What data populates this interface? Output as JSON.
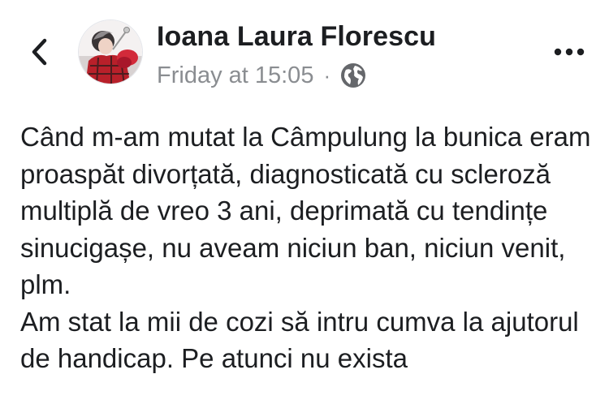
{
  "header": {
    "back_icon": "chevron-left-icon",
    "avatar_icon": "profile-photo",
    "author_name": "Ioana Laura Florescu",
    "timestamp": "Friday at 15:05",
    "separator": "·",
    "privacy_icon": "globe-icon",
    "more_icon": "more-horizontal-icon"
  },
  "post": {
    "paragraphs": [
      "Când m-am mutat la Câmpulung la bunica eram proaspăt divorțată, diagnosticată cu scleroză multiplă de vreo 3 ani, deprimată cu tendințe sinucigașe, nu aveam niciun ban, niciun venit, plm.",
      "Am stat la mii de cozi să intru cumva la ajutorul de handicap. Pe atunci nu exista"
    ]
  }
}
